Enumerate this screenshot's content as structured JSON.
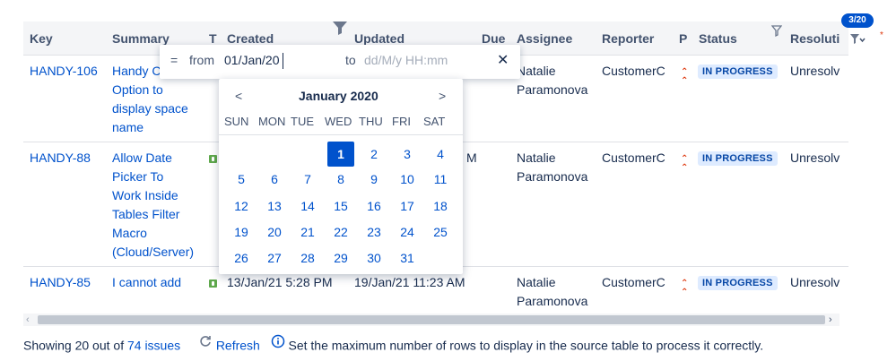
{
  "columns": {
    "key": "Key",
    "summary": "Summary",
    "type": "T",
    "created": "Created",
    "updated": "Updated",
    "due": "Due",
    "assignee": "Assignee",
    "reporter": "Reporter",
    "priority": "P",
    "status": "Status",
    "resolution": "Resoluti"
  },
  "counter": "3/20",
  "rows": [
    {
      "key": "HANDY-106",
      "summary": [
        "Handy C",
        "Option to",
        "display space",
        "name"
      ],
      "created": "",
      "updated": "",
      "assignee": [
        "Natalie",
        "Paramonova"
      ],
      "reporter": "CustomerC",
      "status": "IN PROGRESS",
      "resolution": "Unresolv"
    },
    {
      "key": "HANDY-88",
      "summary": [
        "Allow Date",
        "Picker To",
        "Work Inside",
        "Tables Filter",
        "Macro",
        "(Cloud/Server)"
      ],
      "updated_tail": "M",
      "assignee": [
        "Natalie",
        "Paramonova"
      ],
      "reporter": "CustomerC",
      "status": "IN PROGRESS",
      "resolution": "Unresolv"
    },
    {
      "key": "HANDY-85",
      "summary": [
        "I cannot add"
      ],
      "created": "13/Jan/21 5:28 PM",
      "updated": "19/Jan/21 11:23 AM",
      "assignee": [
        "Natalie",
        "Paramonova"
      ],
      "reporter": "CustomerC",
      "status": "IN PROGRESS",
      "resolution": "Unresolv"
    }
  ],
  "filter": {
    "operator": "=",
    "from_label": "from",
    "from_value": "01/Jan/20",
    "to_label": "to",
    "to_placeholder": "dd/M/y HH:mm",
    "close_glyph": "✕"
  },
  "calendar": {
    "month_title": "January 2020",
    "prev": "<",
    "next": ">",
    "weekdays": [
      "SUN",
      "MON",
      "TUE",
      "WED",
      "THU",
      "FRI",
      "SAT"
    ],
    "selected": "1",
    "weeks": [
      [
        "",
        "",
        "",
        "1",
        "2",
        "3",
        "4"
      ],
      [
        "5",
        "6",
        "7",
        "8",
        "9",
        "10",
        "11"
      ],
      [
        "12",
        "13",
        "14",
        "15",
        "16",
        "17",
        "18"
      ],
      [
        "19",
        "20",
        "21",
        "22",
        "23",
        "24",
        "25"
      ],
      [
        "26",
        "27",
        "28",
        "29",
        "30",
        "31",
        ""
      ]
    ]
  },
  "footer": {
    "showing_prefix": "Showing 20 out of",
    "total_issues": "74 issues",
    "refresh": "Refresh",
    "info": "Set the maximum number of rows to display in the source table to process it correctly."
  },
  "colors": {
    "link": "#0052cc",
    "badge_bg": "#deebff",
    "badge_text": "#0747a6",
    "selected_day": "#0052cc",
    "counter_bg": "#0052cc"
  }
}
